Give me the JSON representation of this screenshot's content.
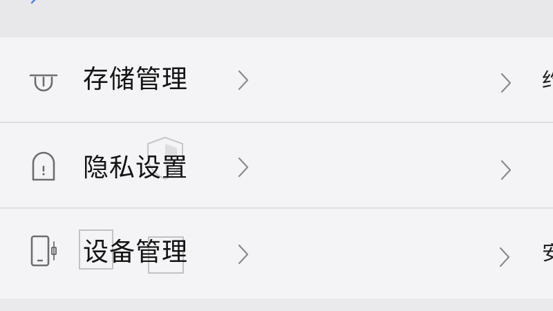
{
  "rows": [
    {
      "label": "存储管理",
      "icon": "storage-icon",
      "edge_glyph": "约"
    },
    {
      "label": "隐私设置",
      "icon": "lock-icon",
      "edge_glyph": ""
    },
    {
      "label": "设备管理",
      "icon": "phone-icon",
      "edge_glyph": "安"
    }
  ],
  "colors": {
    "background": "#efeff1",
    "list_background": "#f4f4f6",
    "divider": "#dedee0",
    "label": "#141414",
    "icon": "#6d6d6d",
    "chevron": "#8a8a8a",
    "back_arrow": "#3b82f6"
  }
}
